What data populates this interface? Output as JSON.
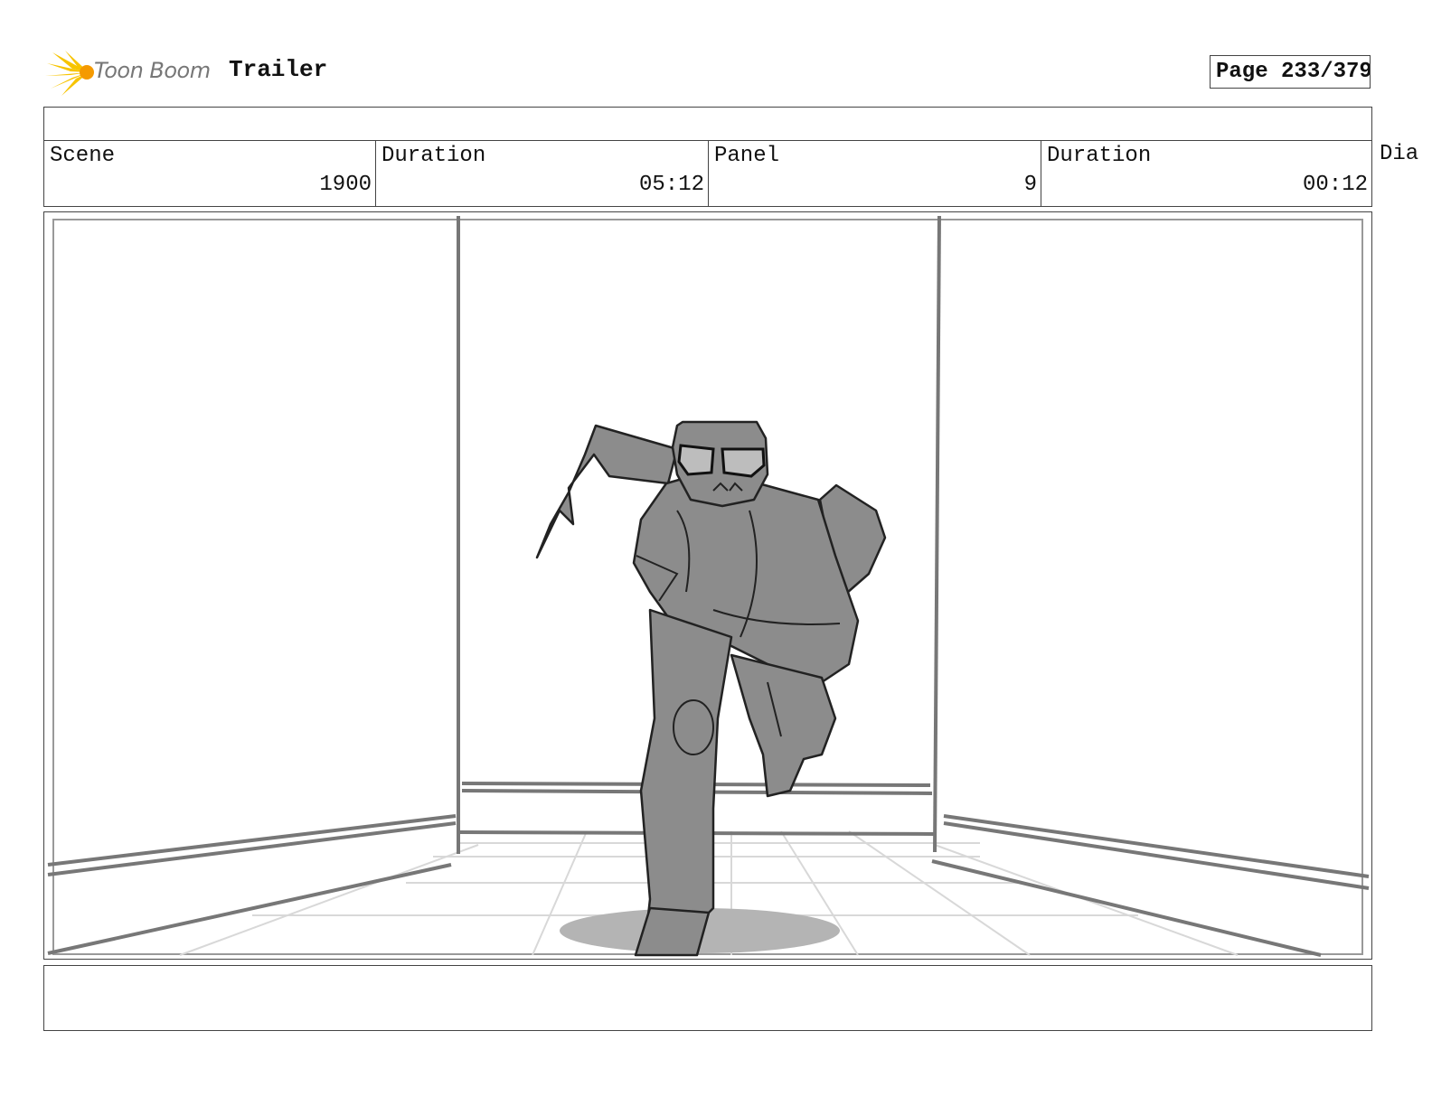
{
  "header": {
    "logo_text": "Toon Boom",
    "project_title": "Trailer",
    "page": "Page 233/379"
  },
  "fields": {
    "scene_label": "Scene",
    "scene_value": "1900",
    "scene_duration_label": "Duration",
    "scene_duration_value": "05:12",
    "panel_label": "Panel",
    "panel_value": "9",
    "panel_duration_label": "Duration",
    "panel_duration_value": "00:12",
    "dialog_label_partial": "Dia"
  },
  "panel": {
    "image": "storyboard-sketch-character-running-down-corridor",
    "colors": {
      "fill": "#8c8c8c",
      "line": "#222222",
      "shadow": "#b4b4b4",
      "floor": "#d8d8d8"
    }
  },
  "dialog": {
    "text": ""
  }
}
